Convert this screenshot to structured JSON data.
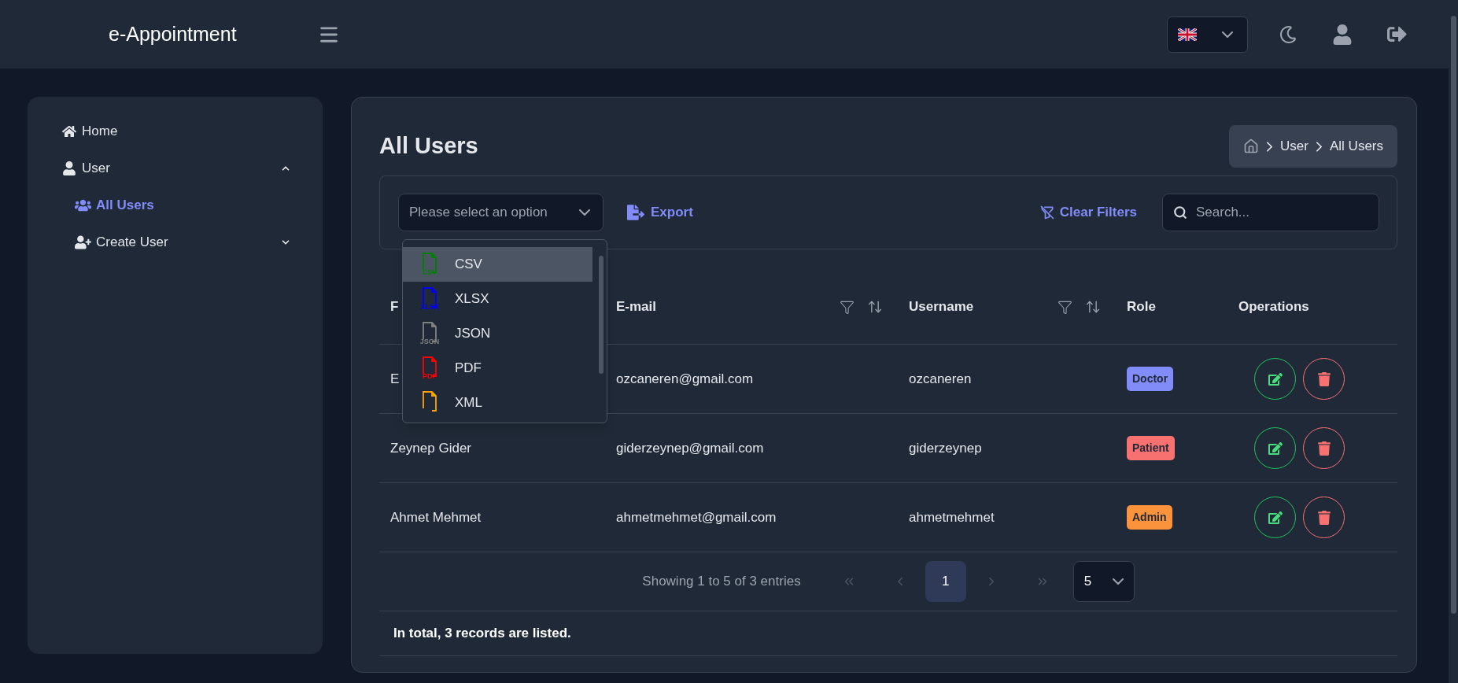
{
  "header": {
    "brand": "e-Appointment"
  },
  "sidebar": {
    "items": [
      {
        "label": "Home",
        "kind": "home",
        "selected": false
      },
      {
        "label": "User",
        "kind": "user",
        "selected": false,
        "expanded": true,
        "children": [
          {
            "label": "All Users",
            "kind": "users",
            "selected": true
          },
          {
            "label": "Create User",
            "kind": "user-plus",
            "selected": false,
            "expanded": false
          }
        ]
      }
    ]
  },
  "page": {
    "title": "All Users",
    "breadcrumb": [
      "User",
      "All Users"
    ]
  },
  "toolbar": {
    "export_select": {
      "placeholder": "Please select an option",
      "options": [
        {
          "label": "CSV",
          "icon_label": "CSV",
          "color": "#008000",
          "selected": true
        },
        {
          "label": "XLSX",
          "icon_label": "XLSX",
          "color": "#0000ff",
          "selected": false
        },
        {
          "label": "JSON",
          "icon_label": "JSON",
          "color": "#808080",
          "selected": false
        },
        {
          "label": "PDF",
          "icon_label": "PDF",
          "color": "#ff0000",
          "selected": false
        },
        {
          "label": "XML",
          "color": "#ffa500",
          "selected": false
        }
      ]
    },
    "export_button": "Export",
    "clear_filters": "Clear Filters",
    "search": {
      "placeholder": "Search..."
    }
  },
  "table": {
    "columns": [
      {
        "label": "F",
        "filterable": false
      },
      {
        "label": "E-mail",
        "filterable": true
      },
      {
        "label": "Username",
        "filterable": true
      },
      {
        "label": "Role",
        "filterable": false
      },
      {
        "label": "Operations",
        "filterable": false
      }
    ],
    "rows": [
      {
        "name": "E",
        "email": "ozcaneren@gmail.com",
        "username": "ozcaneren",
        "role": {
          "label": "Doctor",
          "color": "#818cf8"
        }
      },
      {
        "name": "Zeynep Gider",
        "email": "giderzeynep@gmail.com",
        "username": "giderzeynep",
        "role": {
          "label": "Patient",
          "color": "#f87171"
        }
      },
      {
        "name": "Ahmet Mehmet",
        "email": "ahmetmehmet@gmail.com",
        "username": "ahmetmehmet",
        "role": {
          "label": "Admin",
          "color": "#fb923c"
        }
      }
    ]
  },
  "pagination": {
    "summary": "Showing 1 to 5 of 3 entries",
    "pages": [
      {
        "label": "1",
        "selected": true
      }
    ],
    "page_size": "5"
  },
  "footer": {
    "total": "In total, 3 records are listed."
  }
}
